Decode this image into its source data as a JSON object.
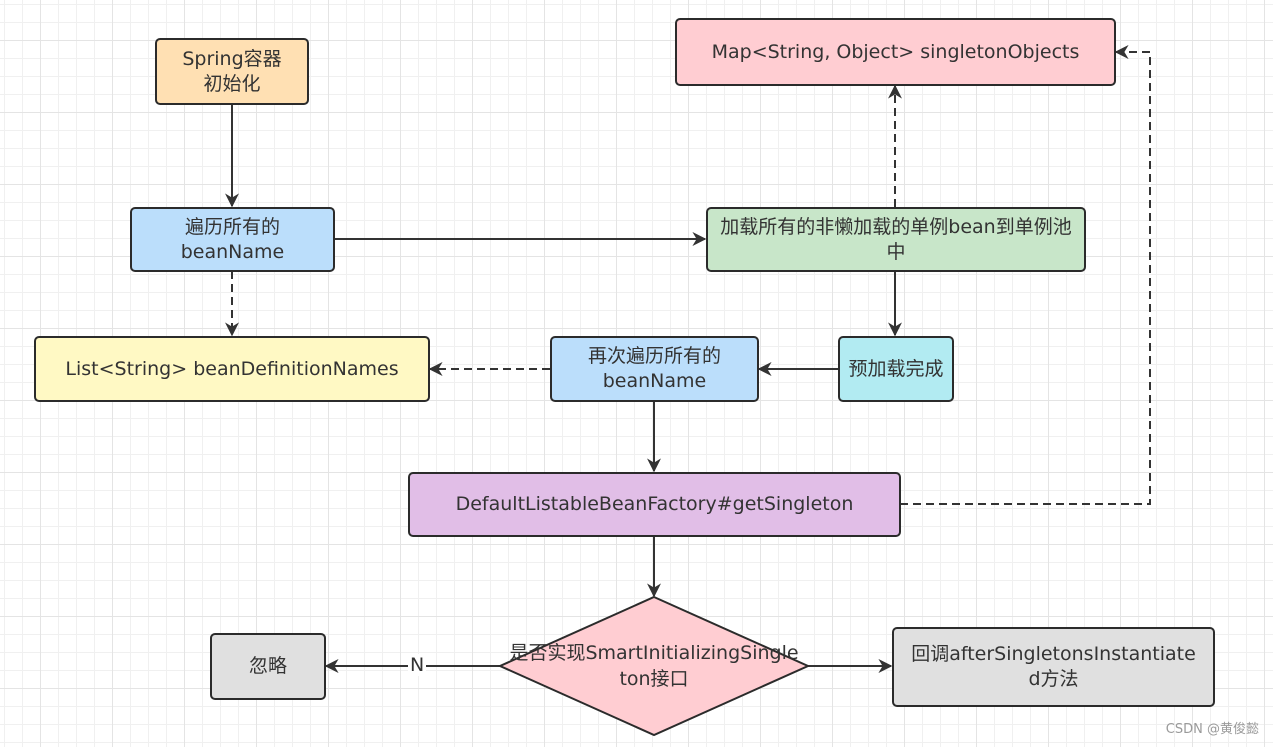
{
  "nodes": {
    "spring_init": {
      "text": "Spring容器初始化",
      "color": "#ffe0b3"
    },
    "traverse": {
      "text": "遍历所有的beanName",
      "color": "#bbdefb"
    },
    "load_singletons": {
      "text": "加载所有的非懒加载的单例bean到单例池中",
      "color": "#c8e6c9"
    },
    "singleton_objects": {
      "text": "Map<String, Object> singletonObjects",
      "color": "#ffcdd2"
    },
    "bean_definition_names": {
      "text": "List<String> beanDefinitionNames",
      "color": "#fff9c4"
    },
    "retraverse": {
      "text": "再次遍历所有的beanName",
      "color": "#bbdefb"
    },
    "preload_done": {
      "text": "预加载完成",
      "color": "#b2ebf2"
    },
    "get_singleton": {
      "text": "DefaultListableBeanFactory#getSingleton",
      "color": "#e1bee7"
    },
    "decision": {
      "text": "是否实现SmartInitializingSingleton接口",
      "color": "#ffcdd2"
    },
    "ignore": {
      "text": "忽略",
      "color": "#e0e0e0"
    },
    "callback": {
      "text": "回调afterSingletonsInstantiated方法",
      "color": "#e0e0e0"
    }
  },
  "edge_labels": {
    "no": "N"
  },
  "watermark": "CSDN @黄俊懿"
}
